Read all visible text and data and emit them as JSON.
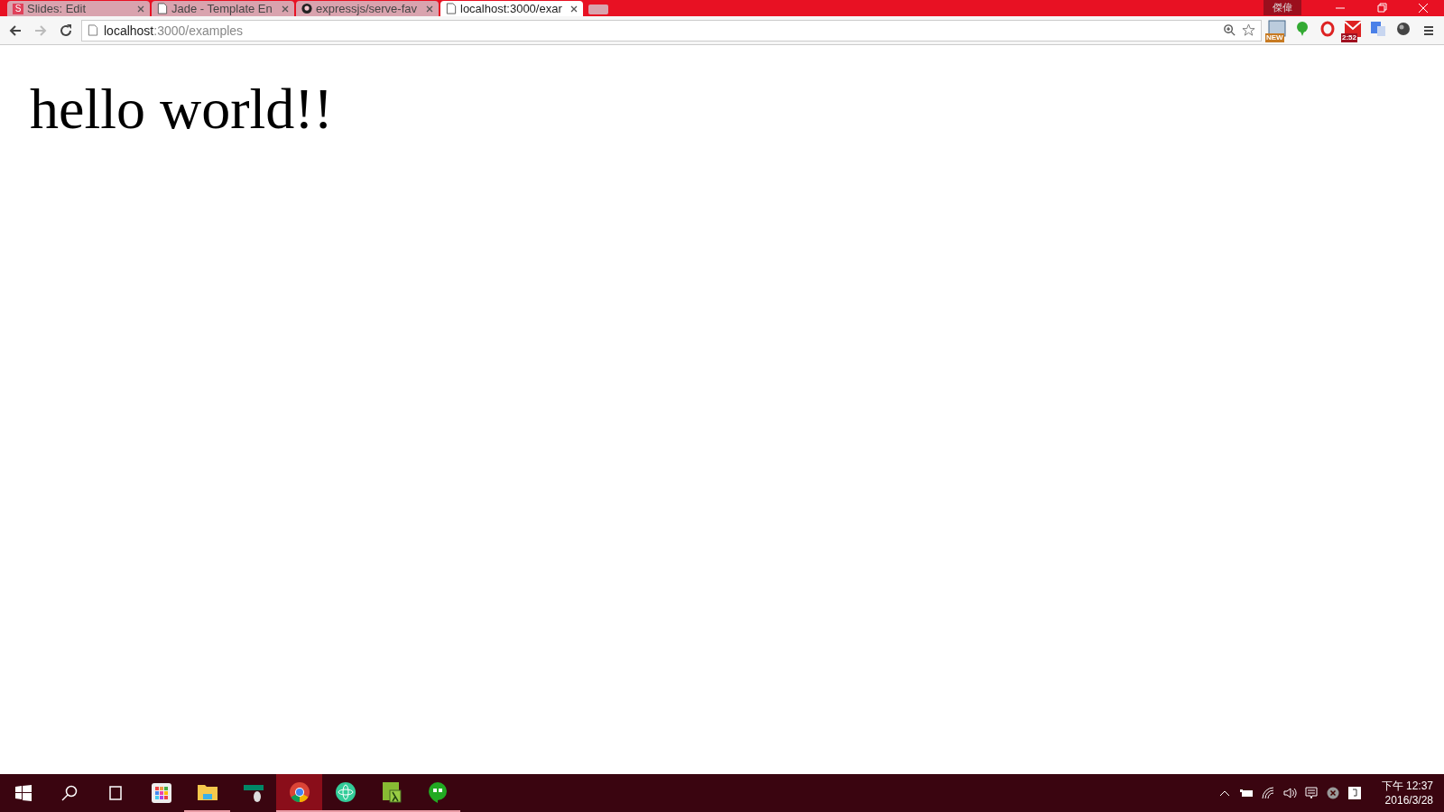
{
  "tabs": [
    {
      "title": "Slides: Edit",
      "kind": "letter",
      "icon_text": "S",
      "selected": false
    },
    {
      "title": "Jade - Template En",
      "kind": "page",
      "selected": false
    },
    {
      "title": "expressjs/serve-fav",
      "kind": "github",
      "selected": false
    },
    {
      "title": "localhost:3000/exar",
      "kind": "page",
      "selected": true
    }
  ],
  "profile": "傑偉",
  "address": {
    "host": "localhost",
    "path": ":3000/examples"
  },
  "extensions": [
    {
      "kind": "calendar",
      "badge": "NEW"
    },
    {
      "kind": "pin"
    },
    {
      "kind": "opera"
    },
    {
      "kind": "mail",
      "badge": "2:52"
    },
    {
      "kind": "translate"
    },
    {
      "kind": "ball"
    }
  ],
  "heading": "hello world!!",
  "taskbar": [
    {
      "kind": "store",
      "running": false,
      "active": false
    },
    {
      "kind": "folder",
      "running": true,
      "active": false
    },
    {
      "kind": "mouse",
      "running": false,
      "active": false
    },
    {
      "kind": "chrome",
      "running": true,
      "active": true
    },
    {
      "kind": "atom",
      "running": true,
      "active": false
    },
    {
      "kind": "lambda",
      "running": true,
      "active": false
    },
    {
      "kind": "hangouts",
      "running": true,
      "active": false
    }
  ],
  "clock": {
    "time": "下午 12:37",
    "date": "2016/3/28"
  }
}
